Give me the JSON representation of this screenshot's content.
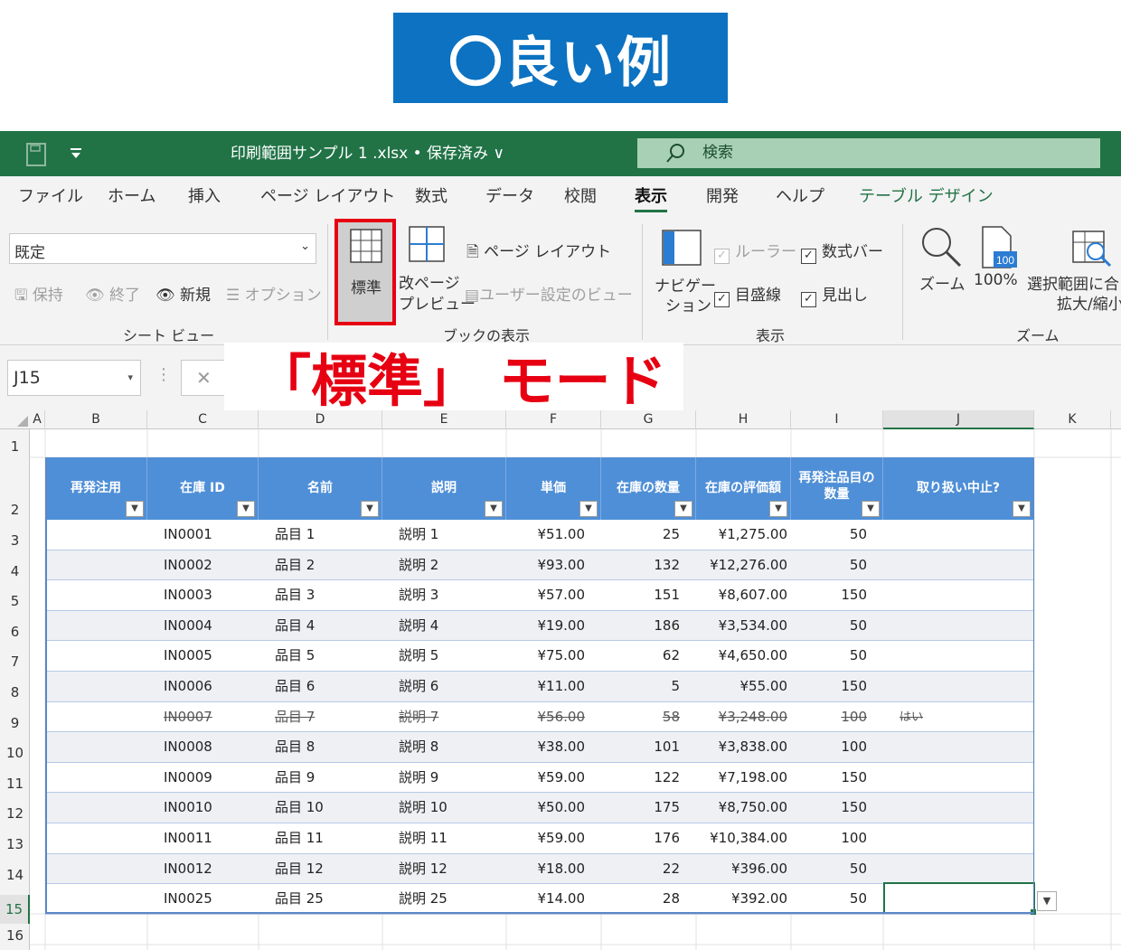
{
  "banner": {
    "text": "〇良い例"
  },
  "titlebar": {
    "document": "印刷範囲サンプル 1 .xlsx • 保存済み ∨",
    "search_placeholder": "検索"
  },
  "menu": {
    "tabs": [
      "ファイル",
      "ホーム",
      "挿入",
      "ページ レイアウト",
      "数式",
      "データ",
      "校閲",
      "表示",
      "開発",
      "ヘルプ",
      "テーブル デザイン"
    ],
    "active": "表示"
  },
  "ribbon": {
    "sheet_view": {
      "select_value": "既定",
      "keep": "保持",
      "exit": "終了",
      "new": "新規",
      "options": "オプション",
      "group_label": "シート ビュー"
    },
    "workbook_views": {
      "normal": "標準",
      "page_break_1": "改ページ",
      "page_break_2": "プレビュー",
      "page_layout": "ページ レイアウト",
      "custom_views": "ユーザー設定のビュー",
      "group_label": "ブックの表示"
    },
    "show": {
      "navigation_1": "ナビゲー",
      "navigation_2": "ション",
      "ruler": "ルーラー",
      "formula_bar": "数式バー",
      "gridlines": "目盛線",
      "headings": "見出し",
      "group_label": "表示"
    },
    "zoom": {
      "zoom": "ズーム",
      "percent": "100%",
      "zoom_percent_icon_text": "100",
      "fit_1": "選択範囲に合",
      "fit_2": "拡大/縮小",
      "group_label": "ズーム"
    }
  },
  "formula_bar": {
    "name_box": "J15",
    "cancel": "✕"
  },
  "callout": {
    "text": "「標準」 モード"
  },
  "columns": [
    "A",
    "B",
    "C",
    "D",
    "E",
    "F",
    "G",
    "H",
    "I",
    "J",
    "K"
  ],
  "rows": [
    "1",
    "2",
    "3",
    "4",
    "5",
    "6",
    "7",
    "8",
    "9",
    "10",
    "11",
    "12",
    "13",
    "14",
    "15",
    "16"
  ],
  "table": {
    "headers": [
      "再発注用",
      "在庫 ID",
      "名前",
      "説明",
      "単価",
      "在庫の数量",
      "在庫の評価額",
      "再発注品目の 数量",
      "取り扱い中止?"
    ],
    "rows": [
      [
        "",
        "IN0001",
        "品目 1",
        "説明 1",
        "¥51.00",
        "25",
        "¥1,275.00",
        "50",
        ""
      ],
      [
        "",
        "IN0002",
        "品目 2",
        "説明 2",
        "¥93.00",
        "132",
        "¥12,276.00",
        "50",
        ""
      ],
      [
        "",
        "IN0003",
        "品目 3",
        "説明 3",
        "¥57.00",
        "151",
        "¥8,607.00",
        "150",
        ""
      ],
      [
        "",
        "IN0004",
        "品目 4",
        "説明 4",
        "¥19.00",
        "186",
        "¥3,534.00",
        "50",
        ""
      ],
      [
        "",
        "IN0005",
        "品目 5",
        "説明 5",
        "¥75.00",
        "62",
        "¥4,650.00",
        "50",
        ""
      ],
      [
        "",
        "IN0006",
        "品目 6",
        "説明 6",
        "¥11.00",
        "5",
        "¥55.00",
        "150",
        ""
      ],
      [
        "",
        "IN0007",
        "品目 7",
        "説明 7",
        "¥56.00",
        "58",
        "¥3,248.00",
        "100",
        "はい"
      ],
      [
        "",
        "IN0008",
        "品目 8",
        "説明 8",
        "¥38.00",
        "101",
        "¥3,838.00",
        "100",
        ""
      ],
      [
        "",
        "IN0009",
        "品目 9",
        "説明 9",
        "¥59.00",
        "122",
        "¥7,198.00",
        "150",
        ""
      ],
      [
        "",
        "IN0010",
        "品目 10",
        "説明 10",
        "¥50.00",
        "175",
        "¥8,750.00",
        "150",
        ""
      ],
      [
        "",
        "IN0011",
        "品目 11",
        "説明 11",
        "¥59.00",
        "176",
        "¥10,384.00",
        "100",
        ""
      ],
      [
        "",
        "IN0012",
        "品目 12",
        "説明 12",
        "¥18.00",
        "22",
        "¥396.00",
        "50",
        ""
      ],
      [
        "",
        "IN0025",
        "品目 25",
        "説明 25",
        "¥14.00",
        "28",
        "¥392.00",
        "50",
        ""
      ]
    ],
    "discontinued_row_index": 6
  },
  "colors": {
    "excel_green": "#217346",
    "header_blue": "#4f8fd7",
    "banner_blue": "#0c72c1",
    "callout_red": "#e60012"
  }
}
